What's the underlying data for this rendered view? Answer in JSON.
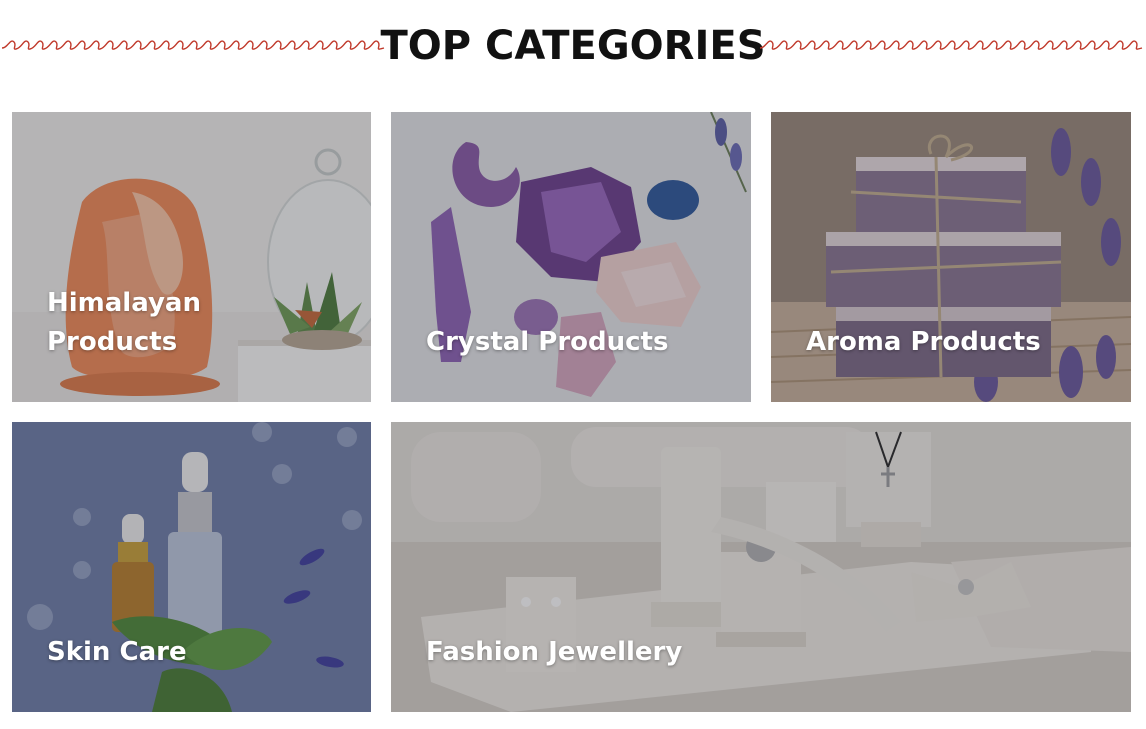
{
  "section": {
    "title": "TOP CATEGORIES",
    "accent_color": "#c0392b"
  },
  "categories": [
    {
      "label": "Himalayan Products",
      "image": "salt-lamp-with-succulent"
    },
    {
      "label": "Crystal Products",
      "image": "amethyst-and-rose-quartz-crystals"
    },
    {
      "label": "Aroma Products",
      "image": "lavender-soap-bars"
    },
    {
      "label": "Skin Care",
      "image": "serum-dropper-bottles"
    },
    {
      "label": "Fashion Jewellery",
      "image": "jewellery-display-stands"
    }
  ]
}
